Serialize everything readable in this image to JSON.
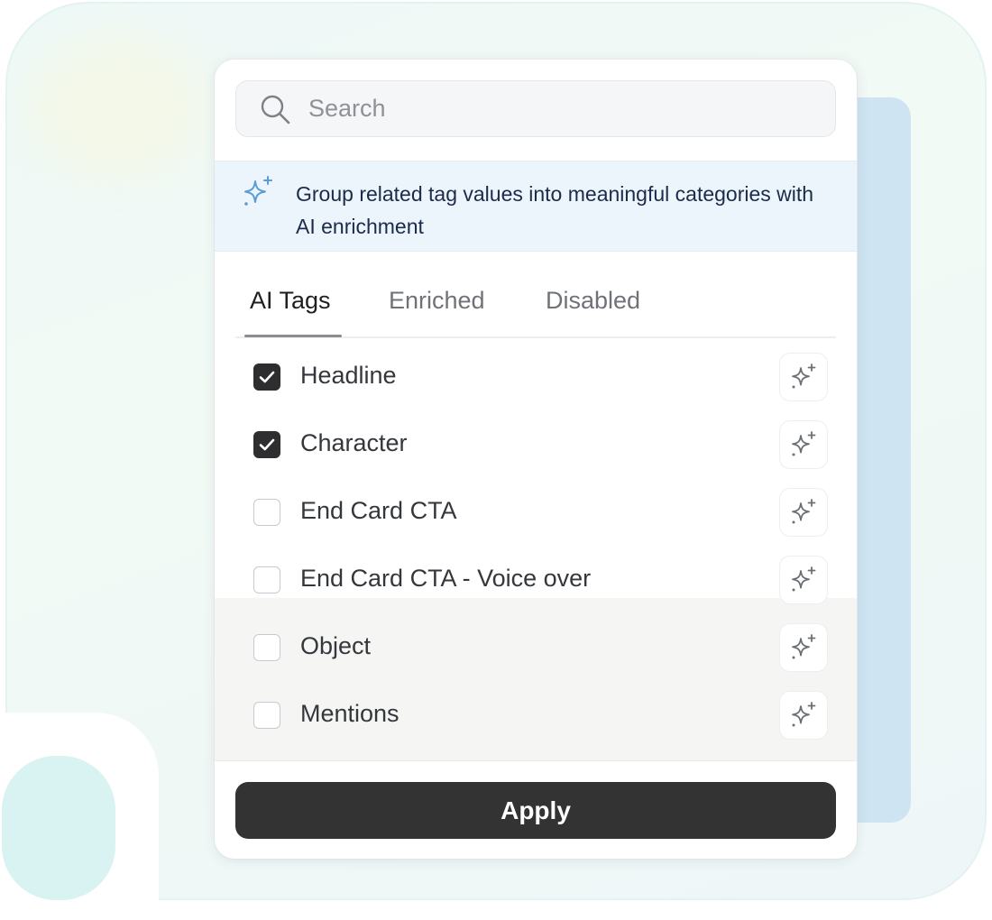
{
  "search": {
    "placeholder": "Search"
  },
  "banner": {
    "text": "Group related tag values into meaningful categories with AI enrichment"
  },
  "tabs": [
    {
      "label": "AI Tags",
      "active": true
    },
    {
      "label": "Enriched",
      "active": false
    },
    {
      "label": "Disabled",
      "active": false
    }
  ],
  "tags": [
    {
      "label": "Headline",
      "checked": true
    },
    {
      "label": "Character",
      "checked": true
    },
    {
      "label": "End Card CTA",
      "checked": false
    },
    {
      "label": "End Card CTA - Voice over",
      "checked": false
    },
    {
      "label": "Object",
      "checked": false
    },
    {
      "label": "Mentions",
      "checked": false
    }
  ],
  "apply_label": "Apply",
  "colors": {
    "accent": "#333333",
    "banner_bg": "#ecf5fb",
    "banner_text": "#1c2b4a",
    "sparkle_icon": "#5a9bd8"
  },
  "icons": {
    "search": "search-icon",
    "banner": "sparkle-icon",
    "row_action": "ai-sparkle-icon",
    "checked": "check-icon"
  }
}
